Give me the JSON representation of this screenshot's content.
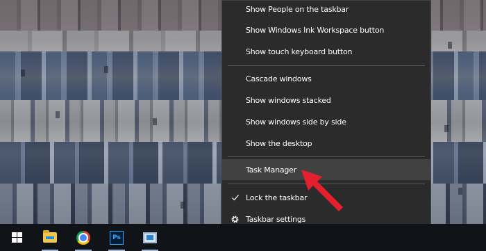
{
  "desktop": {
    "wallpaper": "Paris rooftops cityscape"
  },
  "context_menu": {
    "items": [
      {
        "label": "Show People on the taskbar"
      },
      {
        "label": "Show Windows Ink Workspace button"
      },
      {
        "label": "Show touch keyboard button"
      },
      {
        "label": "Cascade windows"
      },
      {
        "label": "Show windows stacked"
      },
      {
        "label": "Show windows side by side"
      },
      {
        "label": "Show the desktop"
      },
      {
        "label": "Task Manager",
        "highlighted": true
      },
      {
        "label": "Lock the taskbar",
        "checked": true,
        "icon": "check-icon"
      },
      {
        "label": "Taskbar settings",
        "icon": "gear-icon"
      }
    ]
  },
  "taskbar": {
    "buttons": [
      {
        "name": "start-button",
        "icon": "windows-logo-icon"
      },
      {
        "name": "file-explorer",
        "icon": "folder-icon"
      },
      {
        "name": "google-chrome",
        "icon": "chrome-icon"
      },
      {
        "name": "photoshop",
        "icon": "photoshop-icon",
        "text": "Ps"
      },
      {
        "name": "remote-desktop",
        "icon": "remote-desktop-icon"
      }
    ]
  },
  "colors": {
    "menu_background": "#2b2b2b",
    "menu_hover": "#414141",
    "menu_separator": "#5c5c5c",
    "taskbar": "#101418",
    "annotation_arrow": "#e5202e"
  }
}
